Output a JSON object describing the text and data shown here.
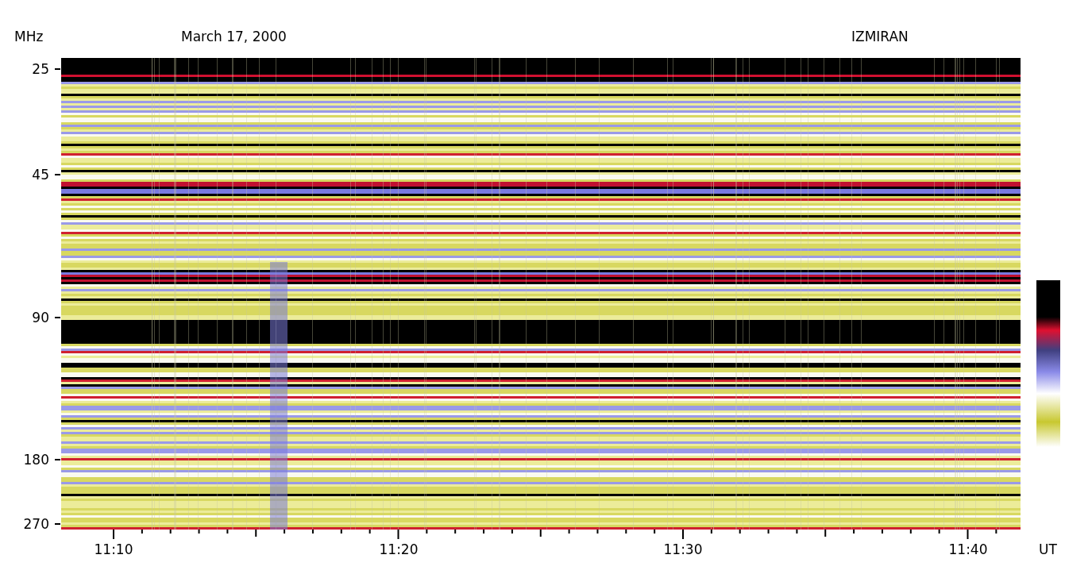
{
  "header": {
    "unit_label": "MHz",
    "date": "March 17, 2000",
    "observatory": "IZMIRAN"
  },
  "frequency_labels": [
    "25",
    "45",
    "90",
    "180",
    "270"
  ],
  "time_labels": [
    "11:10",
    "11:20",
    "11:30",
    "11:40"
  ],
  "time_unit": "UT"
}
